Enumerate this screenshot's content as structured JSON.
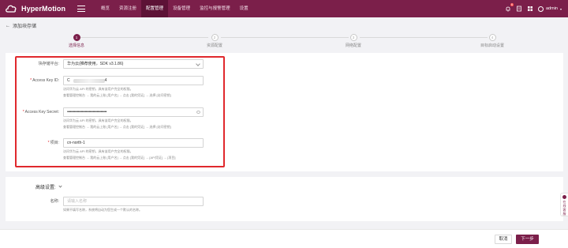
{
  "app": {
    "name": "HyperMotion"
  },
  "nav": [
    {
      "label": "概览",
      "active": false
    },
    {
      "label": "资源注册",
      "active": false
    },
    {
      "label": "配置管理",
      "active": true
    },
    {
      "label": "设备管理",
      "active": false
    },
    {
      "label": "监控与报警管理",
      "active": false
    },
    {
      "label": "设置",
      "active": false
    }
  ],
  "header": {
    "notification_count": "6",
    "user": "admin"
  },
  "breadcrumb": {
    "back_label": "添加块存储"
  },
  "steps": [
    {
      "num": "1",
      "label": "选择信息",
      "active": true
    },
    {
      "num": "2",
      "label": "资源配置",
      "active": false
    },
    {
      "num": "3",
      "label": "网络配置",
      "active": false
    },
    {
      "num": "4",
      "label": "目标启动设置",
      "active": false
    }
  ],
  "form": {
    "platform": {
      "label": "块存储平台:",
      "value": "华为云(推荐使用，SDK v3.1.86)"
    },
    "access_key_id": {
      "label": "Access Key ID:",
      "value_prefix": "C",
      "value_suffix": "4",
      "help1": "访问华为云 API 的密钥，具有该用户完全的权限。",
      "help2": "查看管理控制台 → 我的云上账 [用户名] → 点击 [我的凭证] → 选择 [访问密钥]"
    },
    "access_key_secret": {
      "label": "Access Key Secret:",
      "value": "••••••••••••••••••••••••••••••••••••••••",
      "help1": "访问华为云 API 的密钥，具有该用户完全的权限。",
      "help2": "查看管理控制台 → 我的云上账 [用户名] → 点击 [我的凭证] → 选择 [访问密钥]"
    },
    "project": {
      "label": "项目:",
      "value": "cn-north-1",
      "help1": "访问华为云 API 的密钥，具有该用户完全的权限。",
      "help2": "查看管理控制台 → 我的云上账 [用户名] → 点击 [我的凭证] → [API凭证] → [项目]"
    }
  },
  "advanced": {
    "title": "高级设置:",
    "name_label": "名称:",
    "name_placeholder": "请输入名称",
    "name_help": "如果不填写名称，系统将自动为您生成一个默认的名称。"
  },
  "footer": {
    "cancel": "取消",
    "next": "下一步"
  },
  "side_tab": {
    "line1": "在",
    "line2": "线",
    "line3": "客",
    "line4": "服"
  },
  "colors": {
    "brand": "#7b1f4a",
    "highlight": "#e0282d"
  }
}
